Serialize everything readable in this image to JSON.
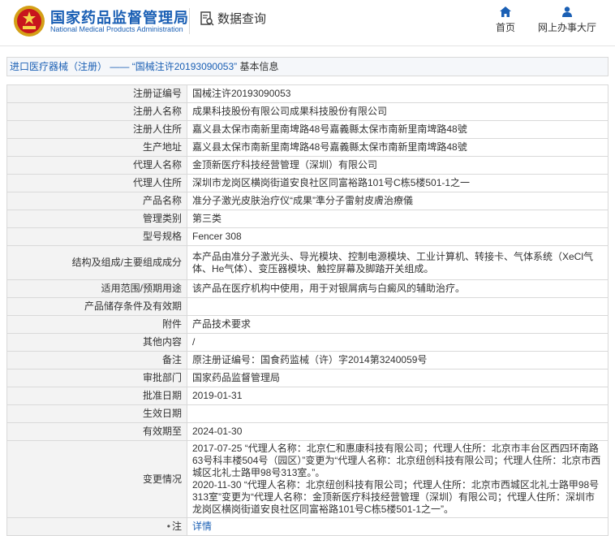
{
  "header": {
    "brand_cn": "国家药品监督管理局",
    "brand_en": "National Medical Products Administration",
    "data_query": "数据查询",
    "nav": [
      {
        "label": "首页",
        "icon": "home-icon"
      },
      {
        "label": "网上办事大厅",
        "icon": "user-icon"
      }
    ],
    "accent": "#1a5fb4"
  },
  "breadcrumb": {
    "part1": "进口医疗器械（注册）",
    "sep": "——",
    "part2": "“国械注许20193090053”",
    "part3": "基本信息"
  },
  "rows": [
    {
      "label": "注册证编号",
      "value": "国械注许20193090053"
    },
    {
      "label": "注册人名称",
      "value": "成果科技股份有限公司成果科技股份有限公司"
    },
    {
      "label": "注册人住所",
      "value": "嘉义县太保市南新里南埤路48号嘉義縣太保市南新里南埤路48號"
    },
    {
      "label": "生产地址",
      "value": "嘉义县太保市南新里南埤路48号嘉義縣太保市南新里南埤路48號"
    },
    {
      "label": "代理人名称",
      "value": "金顶新医疗科技经营管理（深圳）有限公司"
    },
    {
      "label": "代理人住所",
      "value": "深圳市龙岗区横岗街道安良社区同富裕路101号C栋5楼501-1之一"
    },
    {
      "label": "产品名称",
      "value": "准分子激光皮肤治疗仪“成果”準分子雷射皮膚治療儀"
    },
    {
      "label": "管理类别",
      "value": "第三类"
    },
    {
      "label": "型号规格",
      "value": "Fencer 308"
    },
    {
      "label": "结构及组成/主要组成成分",
      "value": "本产品由准分子激光头、导光模块、控制电源模块、工业计算机、转接卡、气体系统（XeCl气体、He气体）、变压器模块、触控屏幕及脚踏开关组成。"
    },
    {
      "label": "适用范围/预期用途",
      "value": "该产品在医疗机构中使用，用于对银屑病与白癜风的辅助治疗。"
    },
    {
      "label": "产品储存条件及有效期",
      "value": ""
    },
    {
      "label": "附件",
      "value": "产品技术要求"
    },
    {
      "label": "其他内容",
      "value": "/"
    },
    {
      "label": "备注",
      "value": "原注册证编号：国食药监械（许）字2014第3240059号"
    },
    {
      "label": "审批部门",
      "value": "国家药品监督管理局"
    },
    {
      "label": "批准日期",
      "value": "2019-01-31"
    },
    {
      "label": "生效日期",
      "value": ""
    },
    {
      "label": "有效期至",
      "value": "2024-01-30"
    },
    {
      "label": "变更情况",
      "value": "2017-07-25 “代理人名称：北京仁和惠康科技有限公司；代理人住所：北京市丰台区西四环南路63号科丰楼504号（园区）”变更为“代理人名称：北京纽创科技有限公司；代理人住所：北京市西城区北礼士路甲98号313室。”。\n2020-11-30 “代理人名称：北京纽创科技有限公司；代理人住所：北京市西城区北礼士路甲98号313室”变更为“代理人名称：金顶新医疗科技经营管理（深圳）有限公司；代理人住所：深圳市龙岗区横岗街道安良社区同富裕路101号C栋5楼501-1之一”。"
    }
  ],
  "note": {
    "label": "注",
    "value": "详情",
    "icon": "lightbulb-icon"
  }
}
